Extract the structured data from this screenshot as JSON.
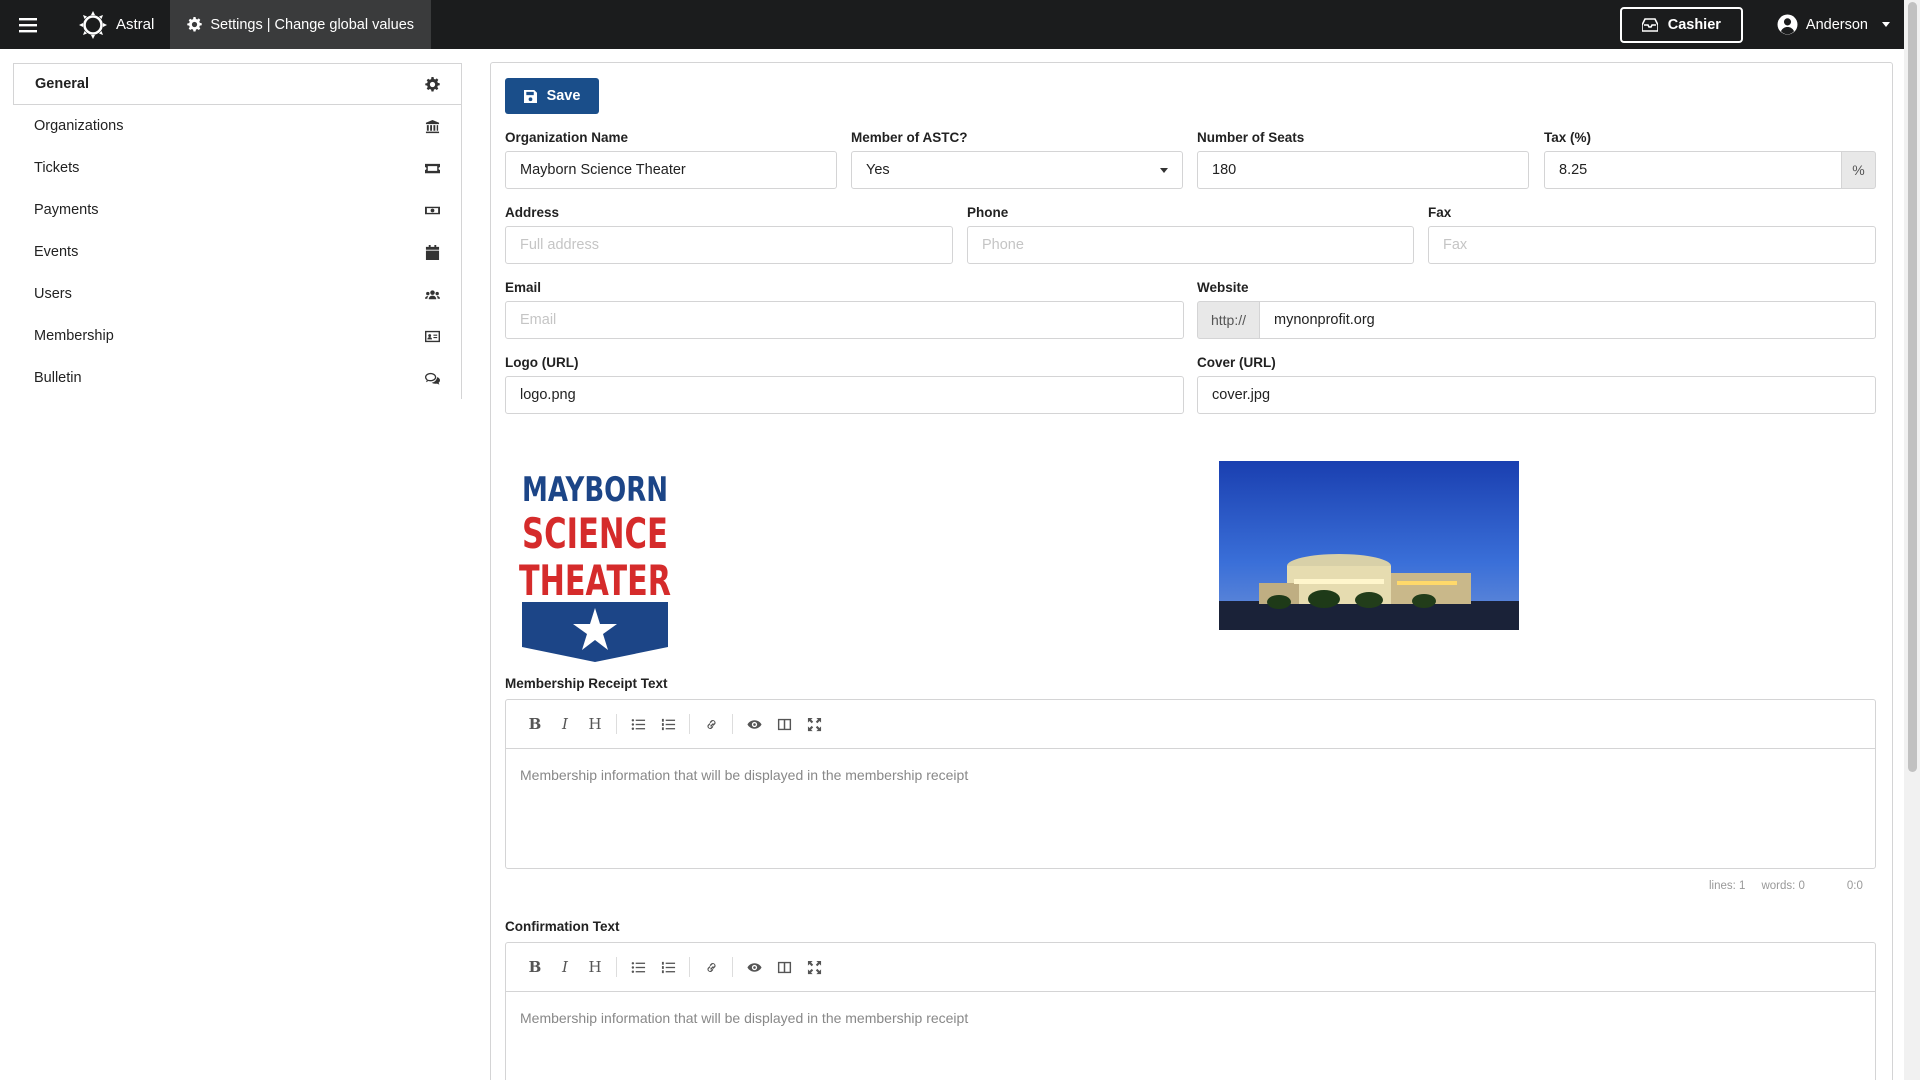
{
  "app": {
    "name": "Astral"
  },
  "header": {
    "breadcrumb": "Settings | Change global values",
    "cashier_label": "Cashier",
    "user_name": "Anderson"
  },
  "sidebar": {
    "items": [
      {
        "label": "General",
        "icon": "gear-icon"
      },
      {
        "label": "Organizations",
        "icon": "building-icon"
      },
      {
        "label": "Tickets",
        "icon": "ticket-icon"
      },
      {
        "label": "Payments",
        "icon": "money-icon"
      },
      {
        "label": "Events",
        "icon": "calendar-icon"
      },
      {
        "label": "Users",
        "icon": "users-icon"
      },
      {
        "label": "Membership",
        "icon": "id-card-icon"
      },
      {
        "label": "Bulletin",
        "icon": "comments-icon"
      }
    ]
  },
  "form": {
    "save_label": "Save",
    "org_name": {
      "label": "Organization Name",
      "value": "Mayborn Science Theater"
    },
    "astc": {
      "label": "Member of ASTC?",
      "value": "Yes"
    },
    "seats": {
      "label": "Number of Seats",
      "value": "180"
    },
    "tax": {
      "label": "Tax (%)",
      "value": "8.25",
      "unit": "%"
    },
    "address": {
      "label": "Address",
      "placeholder": "Full address"
    },
    "phone": {
      "label": "Phone",
      "placeholder": "Phone"
    },
    "fax": {
      "label": "Fax",
      "placeholder": "Fax"
    },
    "email": {
      "label": "Email",
      "placeholder": "Email"
    },
    "website": {
      "label": "Website",
      "prefix": "http://",
      "value": "mynonprofit.org"
    },
    "logo": {
      "label": "Logo (URL)",
      "value": "logo.png"
    },
    "cover": {
      "label": "Cover (URL)",
      "value": "cover.jpg"
    },
    "logo_text": [
      "MAYBORN",
      "SCIENCE",
      "THEATER"
    ],
    "membership_receipt": {
      "label": "Membership Receipt Text",
      "placeholder": "Membership information that will be displayed in the membership receipt",
      "status": {
        "lines": "lines: 1",
        "words": "words: 0",
        "cursor": "0:0"
      }
    },
    "confirmation": {
      "label": "Confirmation Text",
      "placeholder": "Membership information that will be displayed in the membership receipt"
    }
  },
  "colors": {
    "topbar": "#1b1c1d",
    "primary": "#1a4e8a",
    "logo_red": "#d52b2b",
    "logo_blue": "#1c4587"
  }
}
